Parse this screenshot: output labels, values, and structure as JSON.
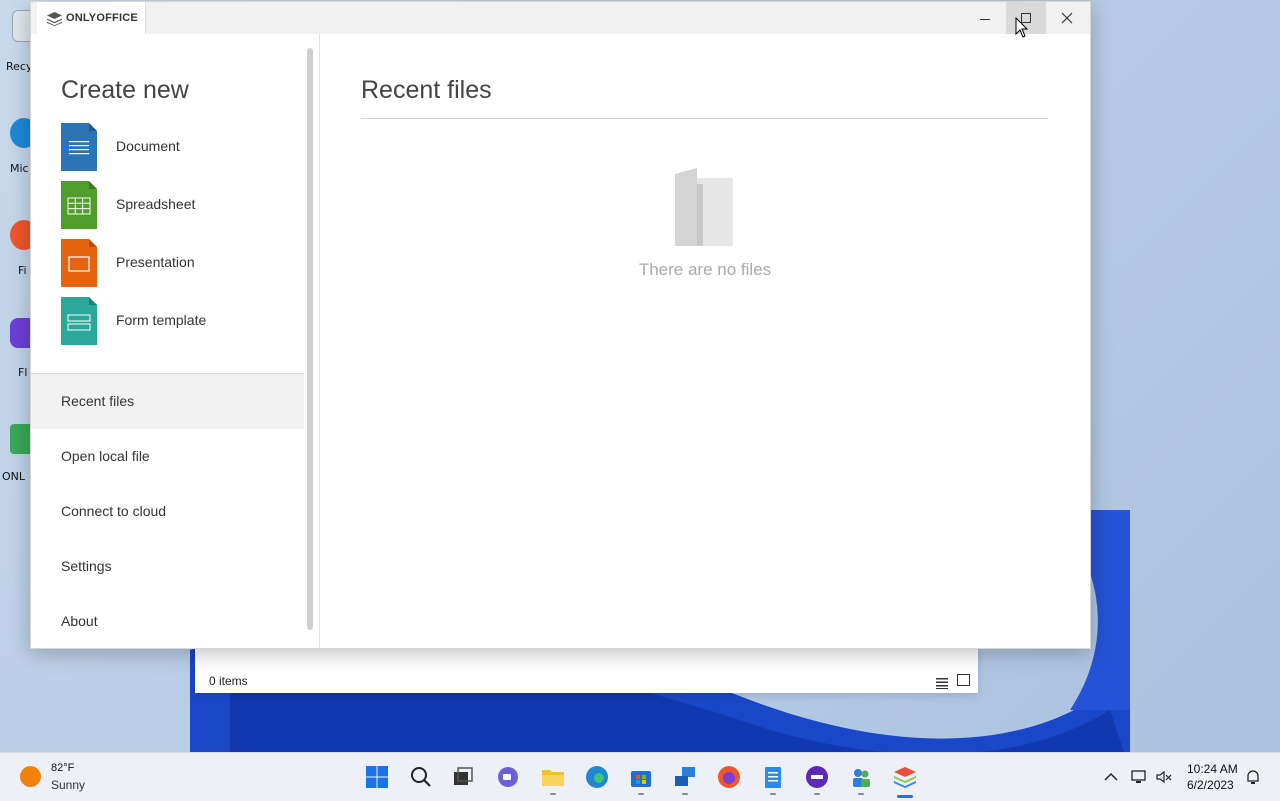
{
  "app": {
    "name": "ONLYOFFICE",
    "create_title": "Create new",
    "create_items": [
      {
        "label": "Document",
        "color": "#2b74b6",
        "icon": "document-icon"
      },
      {
        "label": "Spreadsheet",
        "color": "#4f9e2b",
        "icon": "spreadsheet-icon"
      },
      {
        "label": "Presentation",
        "color": "#e5620f",
        "icon": "presentation-icon"
      },
      {
        "label": "Form template",
        "color": "#2ba89c",
        "icon": "form-template-icon"
      }
    ],
    "nav": [
      {
        "label": "Recent files",
        "active": true
      },
      {
        "label": "Open local file"
      },
      {
        "label": "Connect to cloud"
      },
      {
        "label": "Settings"
      },
      {
        "label": "About"
      }
    ],
    "main": {
      "title": "Recent files",
      "empty_text": "There are no files"
    }
  },
  "background_window": {
    "item_count": "0 items"
  },
  "taskbar": {
    "weather_temp": "82°F",
    "weather_condition": "Sunny",
    "time": "10:24 AM",
    "date": "6/2/2023"
  }
}
